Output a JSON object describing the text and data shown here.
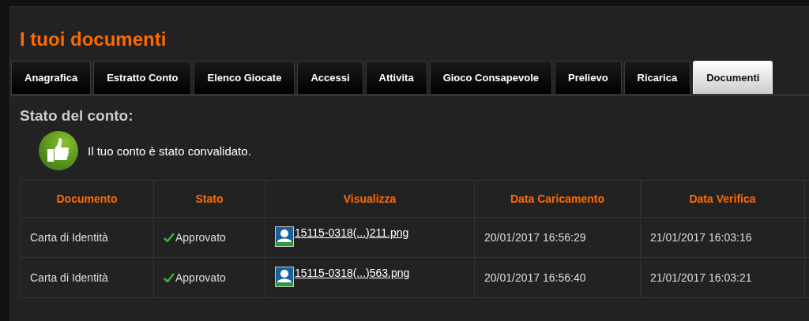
{
  "title": "I tuoi documenti",
  "tabs": [
    {
      "label": "Anagrafica",
      "selected": false
    },
    {
      "label": "Estratto Conto",
      "selected": false
    },
    {
      "label": "Elenco Giocate",
      "selected": false
    },
    {
      "label": "Accessi",
      "selected": false
    },
    {
      "label": "Attivita",
      "selected": false
    },
    {
      "label": "Gioco Consapevole",
      "selected": false
    },
    {
      "label": "Prelievo",
      "selected": false
    },
    {
      "label": "Ricarica",
      "selected": false
    },
    {
      "label": "Documenti",
      "selected": true
    }
  ],
  "account_status": {
    "heading": "Stato del conto:",
    "message": "Il tuo conto è stato convalidato."
  },
  "table": {
    "columns": [
      "Documento",
      "Stato",
      "Visualizza",
      "Data Caricamento",
      "Data Verifica"
    ],
    "rows": [
      {
        "document": "Carta di Identità",
        "status": "Approvato",
        "file": "15115-0318(...)211.png",
        "uploaded": "20/01/2017 16:56:29",
        "verified": "21/01/2017 16:03:16"
      },
      {
        "document": "Carta di Identità",
        "status": "Approvato",
        "file": "15115-0318(...)563.png",
        "uploaded": "20/01/2017 16:56:40",
        "verified": "21/01/2017 16:03:21"
      }
    ]
  }
}
